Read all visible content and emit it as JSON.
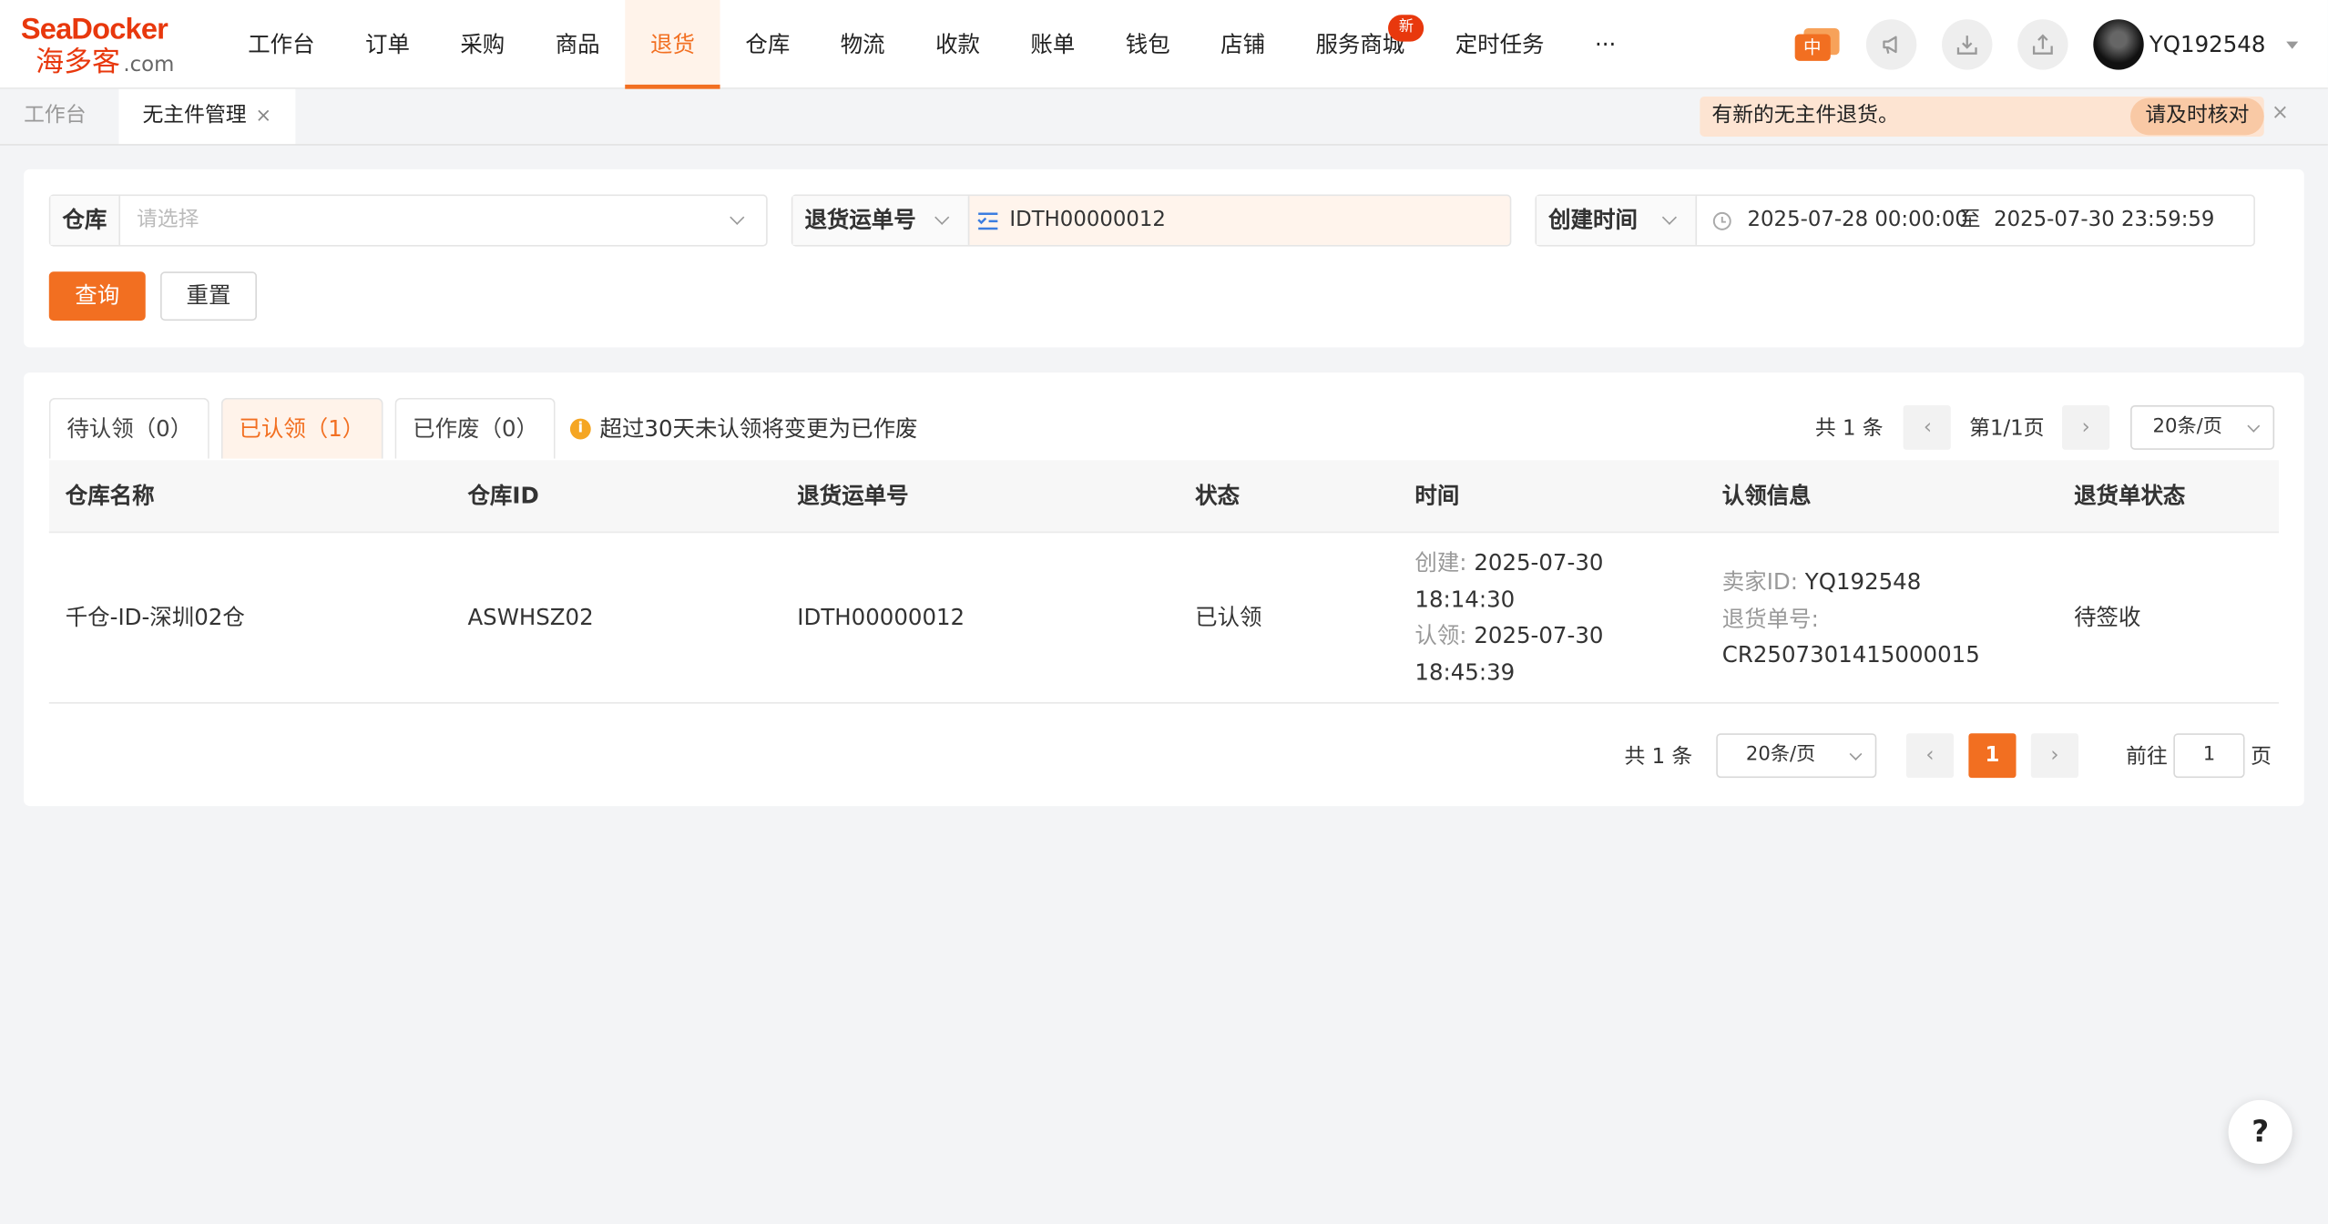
{
  "brand": {
    "line1": "SeaDocker",
    "line2": "海多客",
    "suffix": ".com",
    "color": "#e8380d"
  },
  "nav": {
    "items": [
      "工作台",
      "订单",
      "采购",
      "商品",
      "退货",
      "仓库",
      "物流",
      "收款",
      "账单",
      "钱包",
      "店铺",
      "服务商城",
      "定时任务",
      "···"
    ],
    "active": "退货",
    "badge": "新"
  },
  "header": {
    "lang_label": "中",
    "username": "YQ192548",
    "accent": "#f26f21"
  },
  "tabs": {
    "home": "工作台",
    "current": "无主件管理",
    "close": "×"
  },
  "notice": {
    "text": "有新的无主件退货。",
    "action": "请及时核对",
    "close": "×"
  },
  "filters": {
    "warehouse_label": "仓库",
    "warehouse_placeholder": "请选择",
    "return_no_label": "退货运单号",
    "return_no_value": "IDTH00000012",
    "time_label": "创建时间",
    "time_start": "2025-07-28 00:00:00",
    "time_sep": "至",
    "time_end": "2025-07-30 23:59:59",
    "search_btn": "查询",
    "reset_btn": "重置"
  },
  "status_tabs": [
    {
      "label": "待认领（0）"
    },
    {
      "label": "已认领（1）"
    },
    {
      "label": "已作废（0）"
    }
  ],
  "tip": {
    "icon": "i",
    "text": "超过30天未认领将变更为已作废"
  },
  "pager_top": {
    "total": "共 1 条",
    "page": "第1/1页",
    "size": "20条/页"
  },
  "table": {
    "columns": [
      "仓库名称",
      "仓库ID",
      "退货运单号",
      "状态",
      "时间",
      "认领信息",
      "退货单状态"
    ],
    "rows": [
      {
        "warehouse": "千仓-ID-深圳02仓",
        "warehouse_id": "ASWHSZ02",
        "return_no": "IDTH00000012",
        "status": "已认领",
        "created_label": "创建:",
        "created_date": "2025-07-30",
        "created_time": "18:14:30",
        "claimed_label": "认领:",
        "claimed_date": "2025-07-30",
        "claimed_time": "18:45:39",
        "seller_label": "卖家ID:",
        "seller_id": "YQ192548",
        "order_label": "退货单号:",
        "order_no": "CR2507301415000015",
        "order_status": "待签收"
      }
    ]
  },
  "pager_bottom": {
    "total": "共 1 条",
    "size": "20条/页",
    "current": "1",
    "goto_label": "前往",
    "goto_value": "1",
    "page_unit": "页"
  },
  "help": "?"
}
